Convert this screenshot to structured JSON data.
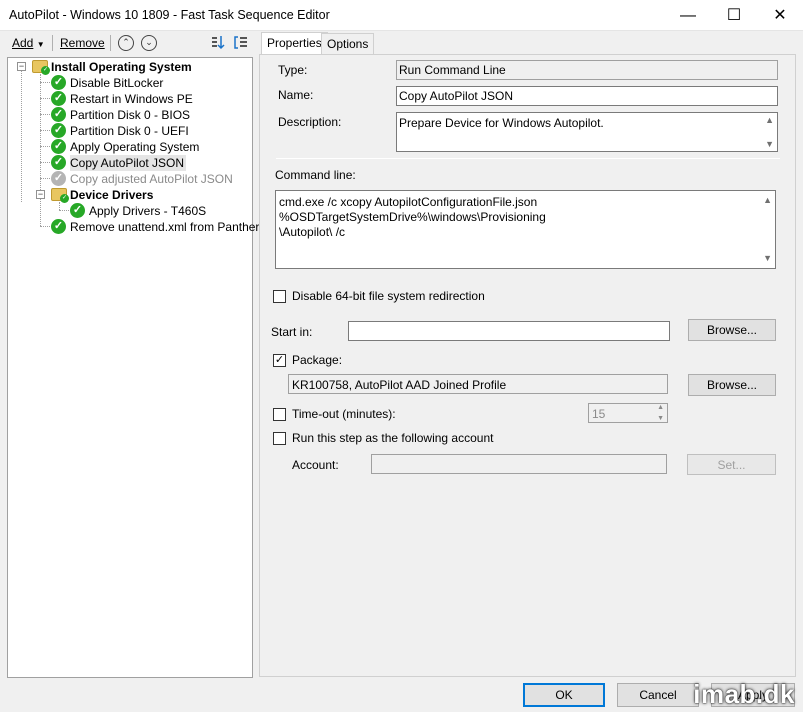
{
  "window": {
    "title": "AutoPilot - Windows 10 1809 - Fast Task Sequence Editor",
    "minimize_glyph": "—",
    "maximize_glyph": "☐",
    "close_glyph": "✕"
  },
  "toolbar": {
    "add_label": "Add",
    "remove_label": "Remove",
    "move_up_glyph": "⌃",
    "move_down_glyph": "⌄"
  },
  "tree": {
    "items": [
      {
        "label": "Install Operating System",
        "type": "group",
        "bold": true,
        "status": "ok"
      },
      {
        "label": "Disable BitLocker",
        "type": "step",
        "status": "ok"
      },
      {
        "label": "Restart in Windows PE",
        "type": "step",
        "status": "ok"
      },
      {
        "label": "Partition Disk 0 - BIOS",
        "type": "step",
        "status": "ok"
      },
      {
        "label": "Partition Disk 0 - UEFI",
        "type": "step",
        "status": "ok"
      },
      {
        "label": "Apply Operating System",
        "type": "step",
        "status": "ok"
      },
      {
        "label": "Copy AutoPilot JSON",
        "type": "step",
        "status": "ok",
        "selected": true
      },
      {
        "label": "Copy adjusted AutoPilot JSON",
        "type": "step",
        "status": "disabled"
      },
      {
        "label": "Device Drivers",
        "type": "group",
        "bold": true,
        "status": "ok"
      },
      {
        "label": "Apply Drivers - T460S",
        "type": "step",
        "status": "ok"
      },
      {
        "label": "Remove unattend.xml from Panther",
        "type": "step",
        "status": "ok"
      }
    ]
  },
  "tabs": [
    {
      "label": "Properties",
      "active": true
    },
    {
      "label": "Options",
      "active": false
    }
  ],
  "properties": {
    "type_label": "Type:",
    "type_value": "Run Command Line",
    "name_label": "Name:",
    "name_value": "Copy AutoPilot JSON",
    "description_label": "Description:",
    "description_value": "Prepare Device for Windows Autopilot.",
    "command_line_label": "Command line:",
    "command_line_value_1": "cmd.exe /c xcopy AutopilotConfigurationFile.json %OSDTargetSystemDrive%\\windows\\Provisioning",
    "command_line_value_2": "\\Autopilot\\ /c",
    "disable64_label": "Disable 64-bit file system redirection",
    "disable64_checked": false,
    "start_in_label": "Start in:",
    "start_in_value": "",
    "browse_label": "Browse...",
    "package_label": "Package:",
    "package_checked": true,
    "package_value": "KR100758, AutoPilot AAD Joined Profile",
    "timeout_label": "Time-out (minutes):",
    "timeout_checked": false,
    "timeout_value": "15",
    "run_as_label": "Run this step as the following account",
    "run_as_checked": false,
    "account_label": "Account:",
    "account_value": "",
    "set_label": "Set..."
  },
  "footer": {
    "ok_label": "OK",
    "cancel_label": "Cancel",
    "apply_label": "Apply"
  },
  "watermark": "imab.dk",
  "colors": {
    "accent": "#0078d7",
    "check_green": "#27a827",
    "disabled_gray": "#b4b4b4"
  }
}
